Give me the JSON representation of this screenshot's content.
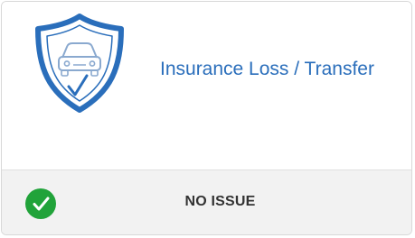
{
  "card": {
    "title": "Insurance Loss / Transfer",
    "icon": "car-shield-check-icon",
    "accent_color": "#2a6ebb"
  },
  "status": {
    "text": "NO ISSUE",
    "icon": "check-circle-icon",
    "color": "#21a33a"
  }
}
